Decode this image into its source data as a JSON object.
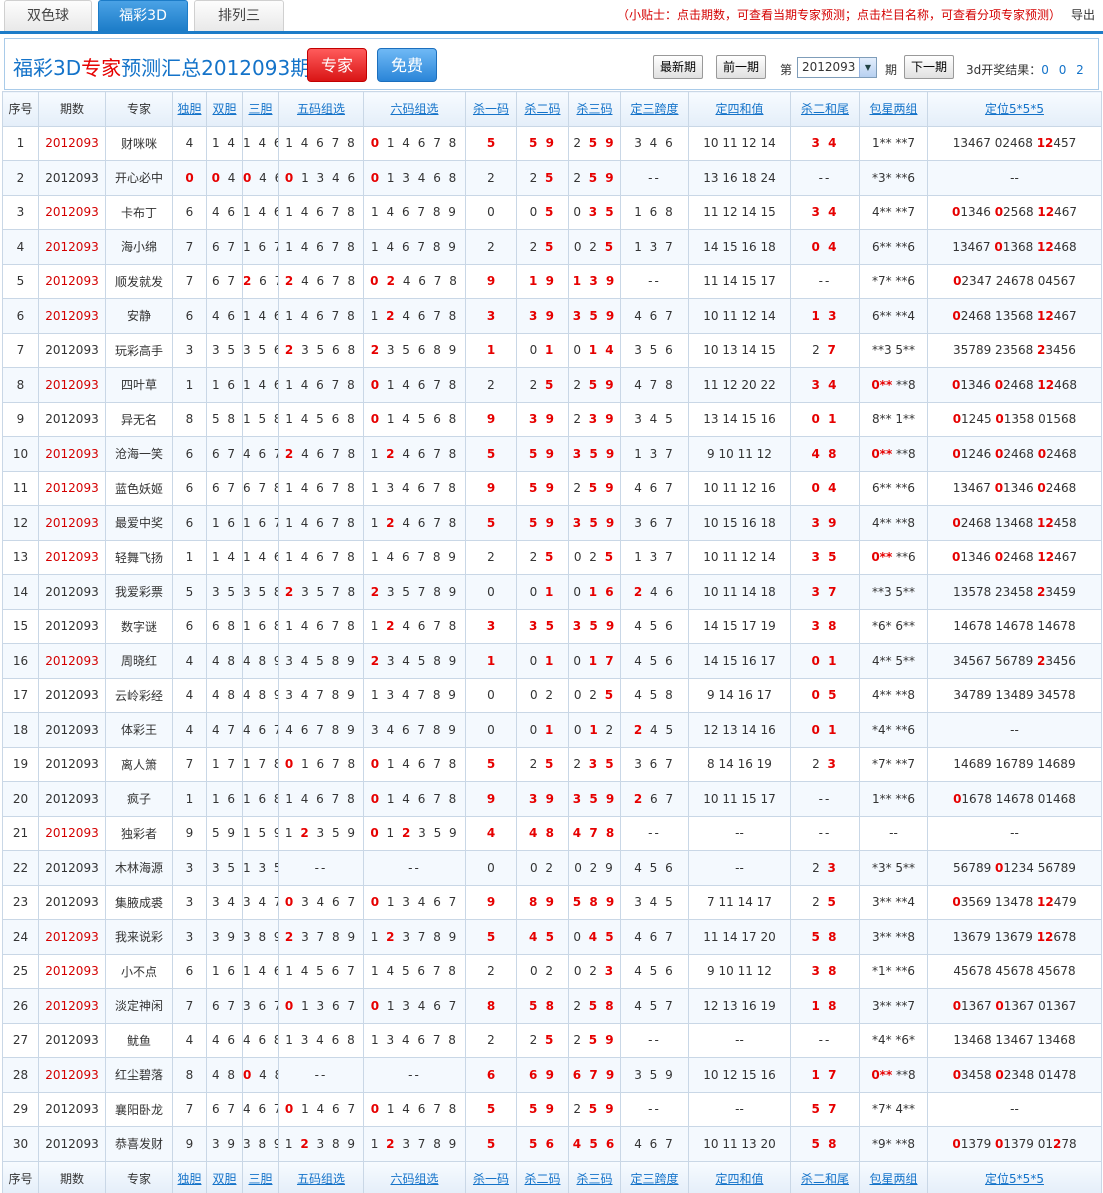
{
  "tabs": [
    "双色球",
    "福彩3D",
    "排列三"
  ],
  "active_tab": 1,
  "tip": "（小贴士：点击期数，可查看当期专家预测；点击栏目名称，可查看分项专家预测）",
  "export": "导出",
  "header": {
    "title_pre": "福彩3D",
    "title_red": "专家",
    "title_post": "预测汇总2012093期",
    "btn_expert": "专家",
    "btn_free": "免费",
    "latest": "最新期",
    "prev": "前一期",
    "di": "第",
    "select_value": "2012093",
    "qi": "期",
    "next": "下一期",
    "result_label": "3d开奖结果：",
    "result_nums": "0 0 2"
  },
  "columns": [
    "序号",
    "期数",
    "专家",
    "独胆",
    "双胆",
    "三胆",
    "五码组选",
    "六码组选",
    "杀一码",
    "杀二码",
    "杀三码",
    "定三跨度",
    "定四和值",
    "杀二和尾",
    "包星两组",
    "定位5*5*5"
  ],
  "footer_columns": [
    "序号",
    "期数",
    "专家",
    "独胆",
    "双胆",
    "三胆",
    "五码组选",
    "六码组选",
    "杀一码",
    "杀二码",
    "杀三码",
    "定三跨度",
    "定四和值",
    "杀二和尾",
    "包星两组",
    "定位5*5*5"
  ],
  "rows": [
    {
      "no": "1",
      "issue": "2012093",
      "red": true,
      "name": "财咪咪",
      "d1": "4",
      "d2": "1 4",
      "d3": "1 4 6",
      "z5": "1 4 6 7 8",
      "z6": "[0] 1 4 6 7 8",
      "k1": "[5]",
      "k2": "[5 9]",
      "k3": "2 [5 9]",
      "kd": "3 4 6",
      "hz": "10 11 12 14",
      "hw": "[3 4]",
      "bx": "1** **7",
      "dw": "13467 02468 [12]457"
    },
    {
      "no": "2",
      "issue": "2012093",
      "red": false,
      "name": "开心必中",
      "d1": "[0]",
      "d2": "[0] 4",
      "d3": "[0] 4 6",
      "z5": "[0] 1 3 4 6",
      "z6": "[0] 1 3 4 6 8",
      "k1": "2",
      "k2": "2 [5]",
      "k3": "2 [5 9]",
      "kd": "--",
      "hz": "13 16 18 24",
      "hw": "--",
      "bx": "*3* **6",
      "dw": "--"
    },
    {
      "no": "3",
      "issue": "2012093",
      "red": true,
      "name": "卡布丁",
      "d1": "6",
      "d2": "4 6",
      "d3": "1 4 6",
      "z5": "1 4 6 7 8",
      "z6": "1 4 6 7 8 9",
      "k1": "0",
      "k2": "0 [5]",
      "k3": "0 [3 5]",
      "kd": "1 6 8",
      "hz": "11 12 14 15",
      "hw": "[3 4]",
      "bx": "4** **7",
      "dw": "[0]1346 [0]2568 [12]467"
    },
    {
      "no": "4",
      "issue": "2012093",
      "red": true,
      "name": "海小绵",
      "d1": "7",
      "d2": "6 7",
      "d3": "1 6 7",
      "z5": "1 4 6 7 8",
      "z6": "1 4 6 7 8 9",
      "k1": "2",
      "k2": "2 [5]",
      "k3": "0 2 [5]",
      "kd": "1 3 7",
      "hz": "14 15 16 18",
      "hw": "[0 4]",
      "bx": "6** **6",
      "dw": "13467 [0]1368 [12]468"
    },
    {
      "no": "5",
      "issue": "2012093",
      "red": true,
      "name": "顺发就发",
      "d1": "7",
      "d2": "6 7",
      "d3": "[2] 6 7",
      "z5": "[2] 4 6 7 8",
      "z6": "[0 2] 4 6 7 8",
      "k1": "[9]",
      "k2": "[1 9]",
      "k3": "[1 3 9]",
      "kd": "--",
      "hz": "11 14 15 17",
      "hw": "--",
      "bx": "*7* **6",
      "dw": "[0]2347 24678 04567"
    },
    {
      "no": "6",
      "issue": "2012093",
      "red": true,
      "name": "安静",
      "d1": "6",
      "d2": "4 6",
      "d3": "1 4 6",
      "z5": "1 4 6 7 8",
      "z6": "1 [2] 4 6 7 8",
      "k1": "[3]",
      "k2": "[3 9]",
      "k3": "[3 5 9]",
      "kd": "4 6 7",
      "hz": "10 11 12 14",
      "hw": "[1 3]",
      "bx": "6** **4",
      "dw": "[0]2468 13568 [12]467"
    },
    {
      "no": "7",
      "issue": "2012093",
      "red": false,
      "name": "玩彩高手",
      "d1": "3",
      "d2": "3 5",
      "d3": "3 5 6",
      "z5": "[2] 3 5 6 8",
      "z6": "[2] 3 5 6 8 9",
      "k1": "[1]",
      "k2": "0 [1]",
      "k3": "0 [1 4]",
      "kd": "3 5 6",
      "hz": "10 13 14 15",
      "hw": "2 [7]",
      "bx": "**3 5**",
      "dw": "35789 23568 [2]3456"
    },
    {
      "no": "8",
      "issue": "2012093",
      "red": true,
      "name": "四叶草",
      "d1": "1",
      "d2": "1 6",
      "d3": "1 4 6",
      "z5": "1 4 6 7 8",
      "z6": "[0] 1 4 6 7 8",
      "k1": "2",
      "k2": "2 [5]",
      "k3": "2 [5 9]",
      "kd": "4 7 8",
      "hz": "11 12 20 22",
      "hw": "[3 4]",
      "bx": "[0**] **8",
      "dw": "[0]1346 [0]2468 [12]468"
    },
    {
      "no": "9",
      "issue": "2012093",
      "red": false,
      "name": "异无名",
      "d1": "8",
      "d2": "5 8",
      "d3": "1 5 8",
      "z5": "1 4 5 6 8",
      "z6": "[0] 1 4 5 6 8",
      "k1": "[9]",
      "k2": "[3 9]",
      "k3": "2 [3 9]",
      "kd": "3 4 5",
      "hz": "13 14 15 16",
      "hw": "[0 1]",
      "bx": "8** 1**",
      "dw": "[0]1245 [0]1358 01568"
    },
    {
      "no": "10",
      "issue": "2012093",
      "red": true,
      "name": "沧海一笑",
      "d1": "6",
      "d2": "6 7",
      "d3": "4 6 7",
      "z5": "[2] 4 6 7 8",
      "z6": "1 [2] 4 6 7 8",
      "k1": "[5]",
      "k2": "[5 9]",
      "k3": "[3 5 9]",
      "kd": "1 3 7",
      "hz": "9 10 11 12",
      "hw": "[4 8]",
      "bx": "[0**] **8",
      "dw": "[0]1246 [0]2468 [0]2468"
    },
    {
      "no": "11",
      "issue": "2012093",
      "red": true,
      "name": "蓝色妖姬",
      "d1": "6",
      "d2": "6 7",
      "d3": "6 7 8",
      "z5": "1 4 6 7 8",
      "z6": "1 3 4 6 7 8",
      "k1": "[9]",
      "k2": "[5 9]",
      "k3": "2 [5 9]",
      "kd": "4 6 7",
      "hz": "10 11 12 16",
      "hw": "[0 4]",
      "bx": "6** **6",
      "dw": "13467 [0]1346 [0]2468"
    },
    {
      "no": "12",
      "issue": "2012093",
      "red": true,
      "name": "最爱中奖",
      "d1": "6",
      "d2": "1 6",
      "d3": "1 6 7",
      "z5": "1 4 6 7 8",
      "z6": "1 [2] 4 6 7 8",
      "k1": "[5]",
      "k2": "[5 9]",
      "k3": "[3 5 9]",
      "kd": "3 6 7",
      "hz": "10 15 16 18",
      "hw": "[3 9]",
      "bx": "4** **8",
      "dw": "[0]2468 13468 [12]458"
    },
    {
      "no": "13",
      "issue": "2012093",
      "red": true,
      "name": "轻舞飞扬",
      "d1": "1",
      "d2": "1 4",
      "d3": "1 4 6",
      "z5": "1 4 6 7 8",
      "z6": "1 4 6 7 8 9",
      "k1": "2",
      "k2": "2 [5]",
      "k3": "0 2 [5]",
      "kd": "1 3 7",
      "hz": "10 11 12 14",
      "hw": "[3 5]",
      "bx": "[0**] **6",
      "dw": "[0]1346 [0]2468 [12]467"
    },
    {
      "no": "14",
      "issue": "2012093",
      "red": false,
      "name": "我爱彩票",
      "d1": "5",
      "d2": "3 5",
      "d3": "3 5 8",
      "z5": "[2] 3 5 7 8",
      "z6": "[2] 3 5 7 8 9",
      "k1": "0",
      "k2": "0 [1]",
      "k3": "0 [1 6]",
      "kd": "[2] 4 6",
      "hz": "10 11 14 18",
      "hw": "[3 7]",
      "bx": "**3 5**",
      "dw": "13578 23458 [2]3459"
    },
    {
      "no": "15",
      "issue": "2012093",
      "red": false,
      "name": "数字谜",
      "d1": "6",
      "d2": "6 8",
      "d3": "1 6 8",
      "z5": "1 4 6 7 8",
      "z6": "1 [2] 4 6 7 8",
      "k1": "[3]",
      "k2": "[3 5]",
      "k3": "[3 5 9]",
      "kd": "4 5 6",
      "hz": "14 15 17 19",
      "hw": "[3 8]",
      "bx": "*6* 6**",
      "dw": "14678 14678 14678"
    },
    {
      "no": "16",
      "issue": "2012093",
      "red": true,
      "name": "周晓红",
      "d1": "4",
      "d2": "4 8",
      "d3": "4 8 9",
      "z5": "3 4 5 8 9",
      "z6": "[2] 3 4 5 8 9",
      "k1": "[1]",
      "k2": "0 [1]",
      "k3": "0 [1 7]",
      "kd": "4 5 6",
      "hz": "14 15 16 17",
      "hw": "[0 1]",
      "bx": "4** 5**",
      "dw": "34567 56789 [2]3456"
    },
    {
      "no": "17",
      "issue": "2012093",
      "red": false,
      "name": "云岭彩经",
      "d1": "4",
      "d2": "4 8",
      "d3": "4 8 9",
      "z5": "3 4 7 8 9",
      "z6": "1 3 4 7 8 9",
      "k1": "0",
      "k2": "0 2",
      "k3": "0 2 [5]",
      "kd": "4 5 8",
      "hz": "9 14 16 17",
      "hw": "[0 5]",
      "bx": "4** **8",
      "dw": "34789 13489 34578"
    },
    {
      "no": "18",
      "issue": "2012093",
      "red": false,
      "name": "体彩王",
      "d1": "4",
      "d2": "4 7",
      "d3": "4 6 7",
      "z5": "4 6 7 8 9",
      "z6": "3 4 6 7 8 9",
      "k1": "0",
      "k2": "0 [1]",
      "k3": "0 [1] 2",
      "kd": "[2] 4 5",
      "hz": "12 13 14 16",
      "hw": "[0 1]",
      "bx": "*4* **6",
      "dw": "--"
    },
    {
      "no": "19",
      "issue": "2012093",
      "red": false,
      "name": "离人箫",
      "d1": "7",
      "d2": "1 7",
      "d3": "1 7 8",
      "z5": "[0] 1 6 7 8",
      "z6": "[0] 1 4 6 7 8",
      "k1": "[5]",
      "k2": "2 [5]",
      "k3": "2 [3 5]",
      "kd": "3 6 7",
      "hz": "8 14 16 19",
      "hw": "2 [3]",
      "bx": "*7* **7",
      "dw": "14689 16789 14689"
    },
    {
      "no": "20",
      "issue": "2012093",
      "red": false,
      "name": "疯子",
      "d1": "1",
      "d2": "1 6",
      "d3": "1 6 8",
      "z5": "1 4 6 7 8",
      "z6": "[0] 1 4 6 7 8",
      "k1": "[9]",
      "k2": "[3 9]",
      "k3": "[3 5 9]",
      "kd": "[2] 6 7",
      "hz": "10 11 15 17",
      "hw": "--",
      "bx": "1** **6",
      "dw": "[0]1678 14678 01468"
    },
    {
      "no": "21",
      "issue": "2012093",
      "red": true,
      "name": "独彩者",
      "d1": "9",
      "d2": "5 9",
      "d3": "1 5 9",
      "z5": "1 [2] 3 5 9",
      "z6": "[0] 1 [2] 3 5 9",
      "k1": "[4]",
      "k2": "[4 8]",
      "k3": "[4 7 8]",
      "kd": "--",
      "hz": "--",
      "hw": "--",
      "bx": "--",
      "dw": "--"
    },
    {
      "no": "22",
      "issue": "2012093",
      "red": false,
      "name": "木林海源",
      "d1": "3",
      "d2": "3 5",
      "d3": "1 3 5",
      "z5": "--",
      "z6": "--",
      "k1": "0",
      "k2": "0 2",
      "k3": "0 2 9",
      "kd": "4 5 6",
      "hz": "--",
      "hw": "2 [3]",
      "bx": "*3* 5**",
      "dw": "56789 [0]1234 56789"
    },
    {
      "no": "23",
      "issue": "2012093",
      "red": false,
      "name": "集腋成裘",
      "d1": "3",
      "d2": "3 4",
      "d3": "3 4 7",
      "z5": "[0] 3 4 6 7",
      "z6": "[0] 1 3 4 6 7",
      "k1": "[9]",
      "k2": "[8 9]",
      "k3": "[5 8 9]",
      "kd": "3 4 5",
      "hz": "7 11 14 17",
      "hw": "2 [5]",
      "bx": "3** **4",
      "dw": "[0]3569 13478 [12]479"
    },
    {
      "no": "24",
      "issue": "2012093",
      "red": true,
      "name": "我来说彩",
      "d1": "3",
      "d2": "3 9",
      "d3": "3 8 9",
      "z5": "[2] 3 7 8 9",
      "z6": "1 [2] 3 7 8 9",
      "k1": "[5]",
      "k2": "[4 5]",
      "k3": "0 [4 5]",
      "kd": "4 6 7",
      "hz": "11 14 17 20",
      "hw": "[5 8]",
      "bx": "3** **8",
      "dw": "13679 13679 [12]678"
    },
    {
      "no": "25",
      "issue": "2012093",
      "red": true,
      "name": "小不点",
      "d1": "6",
      "d2": "1 6",
      "d3": "1 4 6",
      "z5": "1 4 5 6 7",
      "z6": "1 4 5 6 7 8",
      "k1": "2",
      "k2": "0 2",
      "k3": "0 2 [3]",
      "kd": "4 5 6",
      "hz": "9 10 11 12",
      "hw": "[3 8]",
      "bx": "*1* **6",
      "dw": "45678 45678 45678"
    },
    {
      "no": "26",
      "issue": "2012093",
      "red": true,
      "name": "淡定神闲",
      "d1": "7",
      "d2": "6 7",
      "d3": "3 6 7",
      "z5": "[0] 1 3 6 7",
      "z6": "[0] 1 3 4 6 7",
      "k1": "[8]",
      "k2": "[5 8]",
      "k3": "2 [5 8]",
      "kd": "4 5 7",
      "hz": "12 13 16 19",
      "hw": "[1 8]",
      "bx": "3** **7",
      "dw": "[0]1367 [0]1367 01367"
    },
    {
      "no": "27",
      "issue": "2012093",
      "red": false,
      "name": "鱿鱼",
      "d1": "4",
      "d2": "4 6",
      "d3": "4 6 8",
      "z5": "1 3 4 6 8",
      "z6": "1 3 4 6 7 8",
      "k1": "2",
      "k2": "2 [5]",
      "k3": "2 [5 9]",
      "kd": "--",
      "hz": "--",
      "hw": "--",
      "bx": "*4* *6*",
      "dw": "13468 13467 13468"
    },
    {
      "no": "28",
      "issue": "2012093",
      "red": true,
      "name": "红尘碧落",
      "d1": "8",
      "d2": "4 8",
      "d3": "[0] 4 8",
      "z5": "--",
      "z6": "--",
      "k1": "[6]",
      "k2": "[6 9]",
      "k3": "[6 7 9]",
      "kd": "3 5 9",
      "hz": "10 12 15 16",
      "hw": "[1 7]",
      "bx": "[0**] **8",
      "dw": "[0]3458 [0]2348 01478"
    },
    {
      "no": "29",
      "issue": "2012093",
      "red": false,
      "name": "襄阳卧龙",
      "d1": "7",
      "d2": "6 7",
      "d3": "4 6 7",
      "z5": "[0] 1 4 6 7",
      "z6": "[0] 1 4 6 7 8",
      "k1": "[5]",
      "k2": "[5 9]",
      "k3": "2 [5 9]",
      "kd": "--",
      "hz": "--",
      "hw": "[5 7]",
      "bx": "*7* 4**",
      "dw": "--"
    },
    {
      "no": "30",
      "issue": "2012093",
      "red": false,
      "name": "恭喜发财",
      "d1": "9",
      "d2": "3 9",
      "d3": "3 8 9",
      "z5": "1 [2] 3 8 9",
      "z6": "1 [2] 3 7 8 9",
      "k1": "[5]",
      "k2": "[5 6]",
      "k3": "[4 5 6]",
      "kd": "4 6 7",
      "hz": "10 11 13 20",
      "hw": "[5 8]",
      "bx": "*9* **8",
      "dw": "[0]1379 [0]1379 01[2]78"
    }
  ]
}
